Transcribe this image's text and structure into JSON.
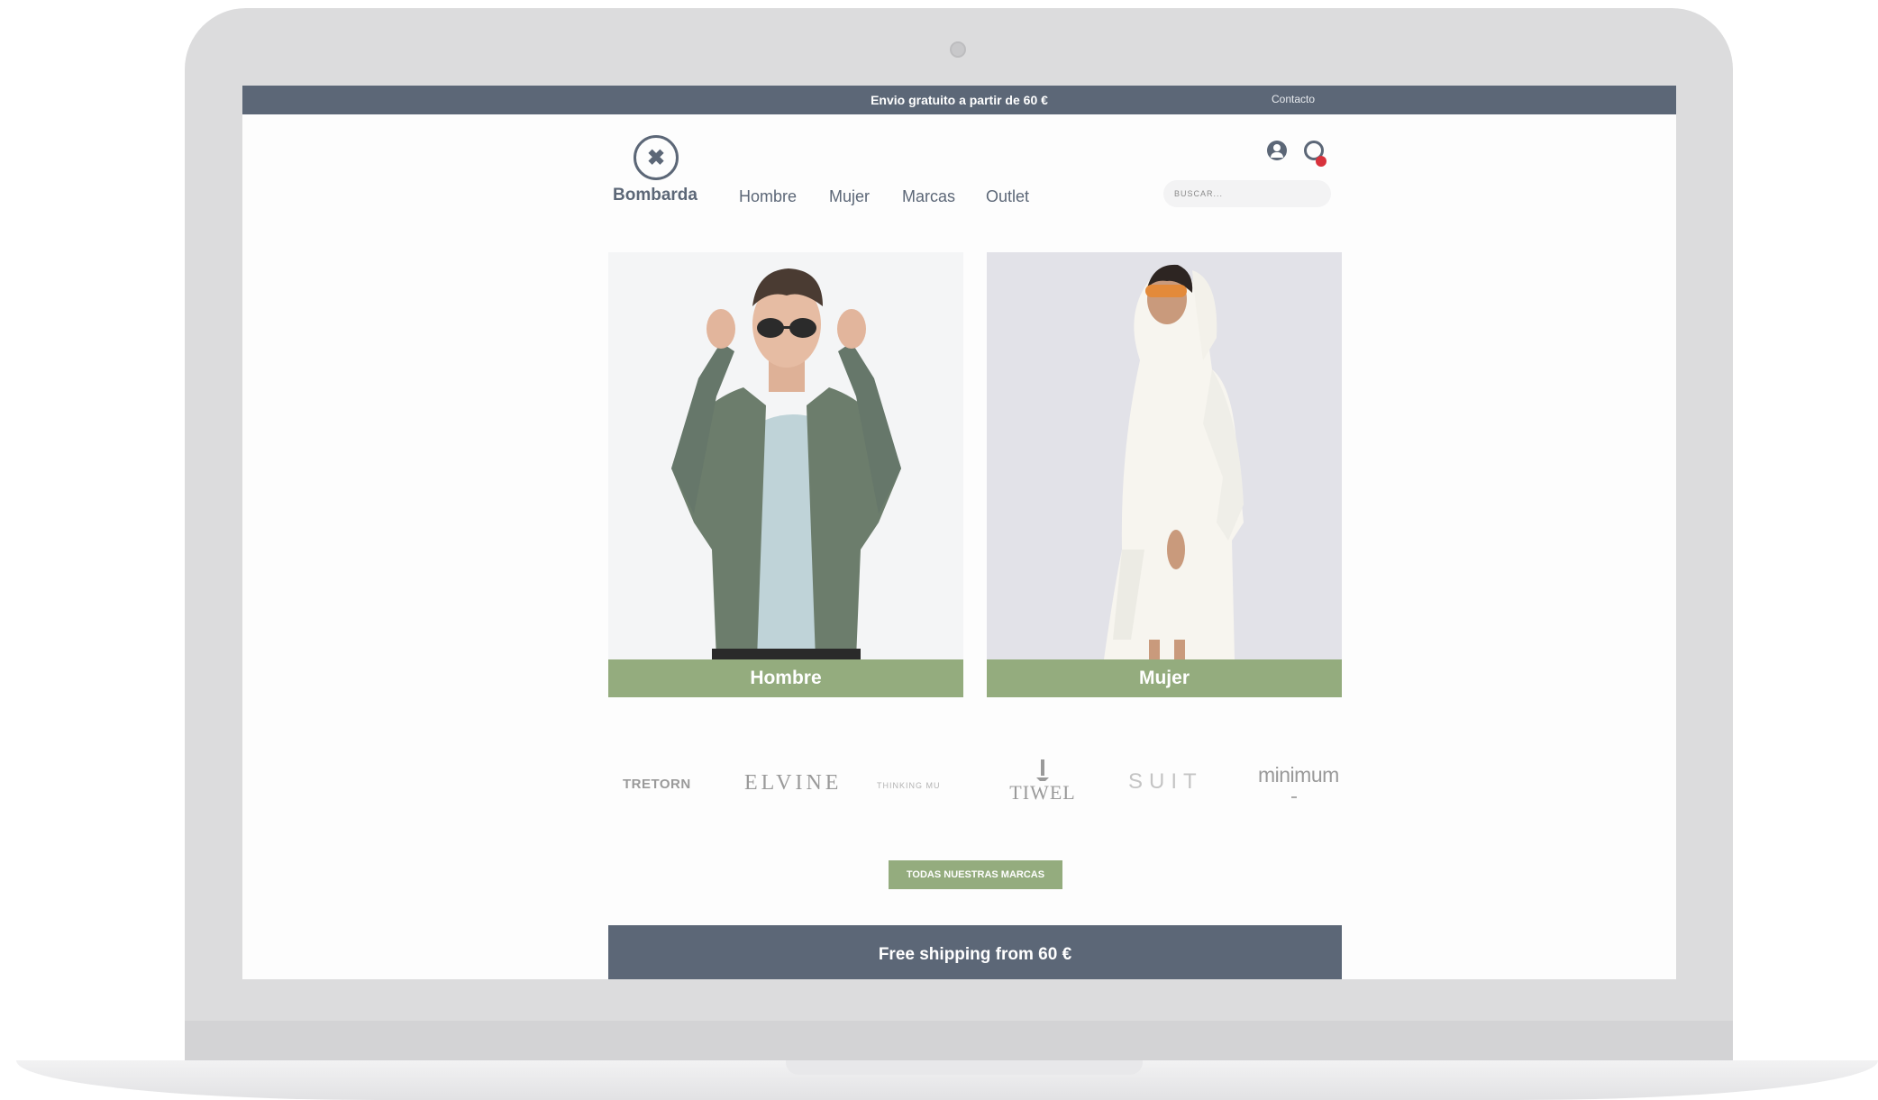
{
  "topbar": {
    "promo": "Envio gratuito a partir de 60 €",
    "contact": "Contacto"
  },
  "header": {
    "logo_mark": "✖",
    "brand_name": "Bombarda",
    "nav": [
      "Hombre",
      "Mujer",
      "Marcas",
      "Outlet"
    ],
    "search_placeholder": "BUSCAR...",
    "icons": [
      "user-icon",
      "cart-icon"
    ]
  },
  "categories": [
    {
      "label": "Hombre"
    },
    {
      "label": "Mujer"
    }
  ],
  "brands": [
    "TRETORN",
    "ELVINE",
    "THINKING MU",
    "TIWEL",
    "SUIT",
    "minimum"
  ],
  "brands_button": "TODAS NUESTRAS MARCAS",
  "footer_banner": "Free shipping from 60 €",
  "colors": {
    "dark_slate": "#5c6777",
    "sage_green": "#94ac7e",
    "badge_red": "#d8323c"
  }
}
